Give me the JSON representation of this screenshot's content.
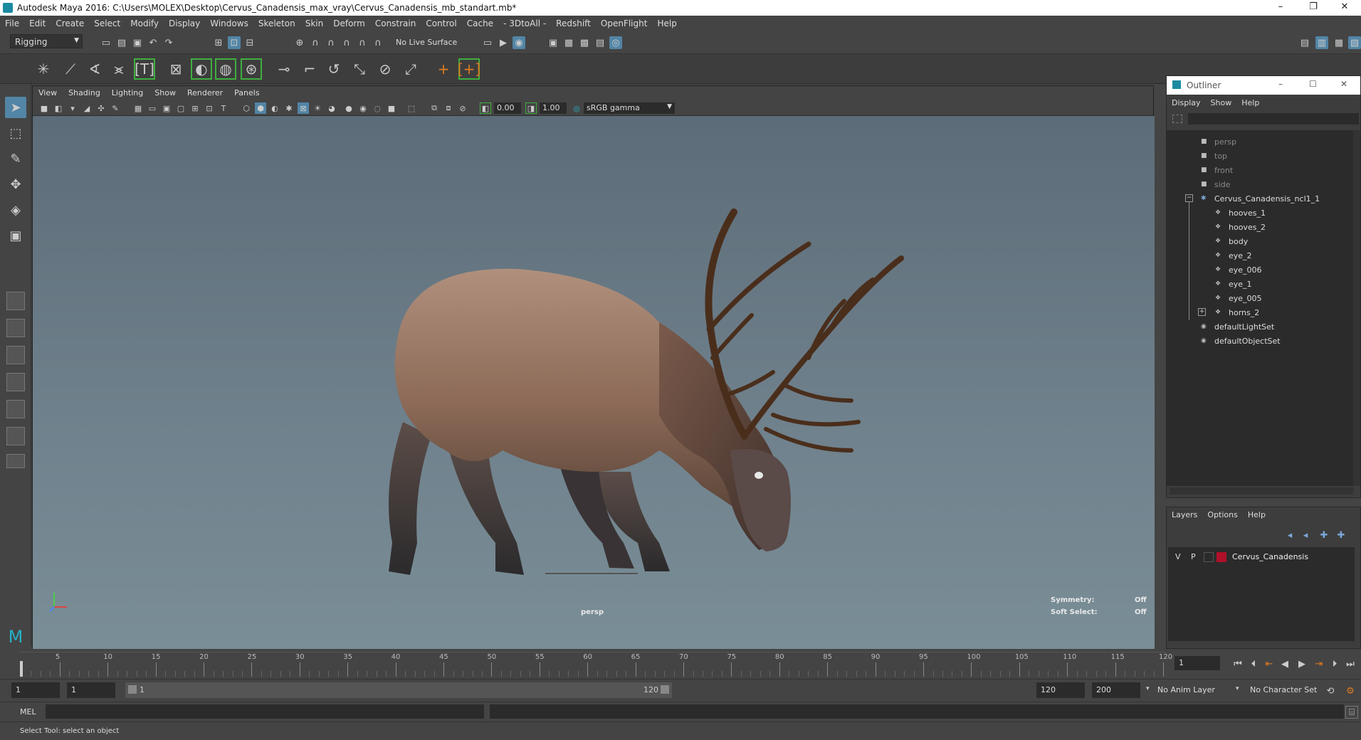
{
  "window": {
    "title": "Autodesk Maya 2016: C:\\Users\\MOLEX\\Desktop\\Cervus_Canadensis_max_vray\\Cervus_Canadensis_mb_standart.mb*",
    "minimize": "–",
    "restore": "❐",
    "close": "✕"
  },
  "menubar": [
    "File",
    "Edit",
    "Create",
    "Select",
    "Modify",
    "Display",
    "Windows",
    "Skeleton",
    "Skin",
    "Deform",
    "Constrain",
    "Control",
    "Cache",
    "- 3DtoAll -",
    "Redshift",
    "OpenFlight",
    "Help"
  ],
  "status": {
    "menuset": "Rigging",
    "live_surface": "No Live Surface"
  },
  "viewport": {
    "menu": [
      "View",
      "Shading",
      "Lighting",
      "Show",
      "Renderer",
      "Panels"
    ],
    "exposure": "0.00",
    "gamma": "1.00",
    "color_space": "sRGB gamma",
    "camera_label": "persp",
    "symmetry_label": "Symmetry:",
    "symmetry_value": "Off",
    "soft_select_label": "Soft Select:",
    "soft_select_value": "Off"
  },
  "outliner": {
    "title": "Outliner",
    "menu": [
      "Display",
      "Show",
      "Help"
    ],
    "cameras": [
      "persp",
      "top",
      "front",
      "side"
    ],
    "root": "Cervus_Canadensis_ncl1_1",
    "children": [
      "hooves_1",
      "hooves_2",
      "body",
      "eye_2",
      "eye_006",
      "eye_1",
      "eye_005",
      "horns_2"
    ],
    "sets": [
      "defaultLightSet",
      "defaultObjectSet"
    ]
  },
  "layers": {
    "menu": [
      "Layers",
      "Options",
      "Help"
    ],
    "layer": {
      "v": "V",
      "p": "P",
      "name": "Cervus_Canadensis",
      "color": "#b0102a"
    }
  },
  "timeline": {
    "ticks": [
      5,
      10,
      15,
      20,
      25,
      30,
      35,
      40,
      45,
      50,
      55,
      60,
      65,
      70,
      75,
      80,
      85,
      90,
      95,
      100,
      105,
      110,
      115,
      120
    ],
    "current_frame": "1"
  },
  "range": {
    "start": "1",
    "playback_start": "1",
    "slider_start": "1",
    "slider_end": "120",
    "playback_end": "120",
    "end": "200",
    "anim_layer": "No Anim Layer",
    "character_set": "No Character Set"
  },
  "cmdline": {
    "label": "MEL"
  },
  "helpline": {
    "text": "Select Tool: select an object"
  }
}
